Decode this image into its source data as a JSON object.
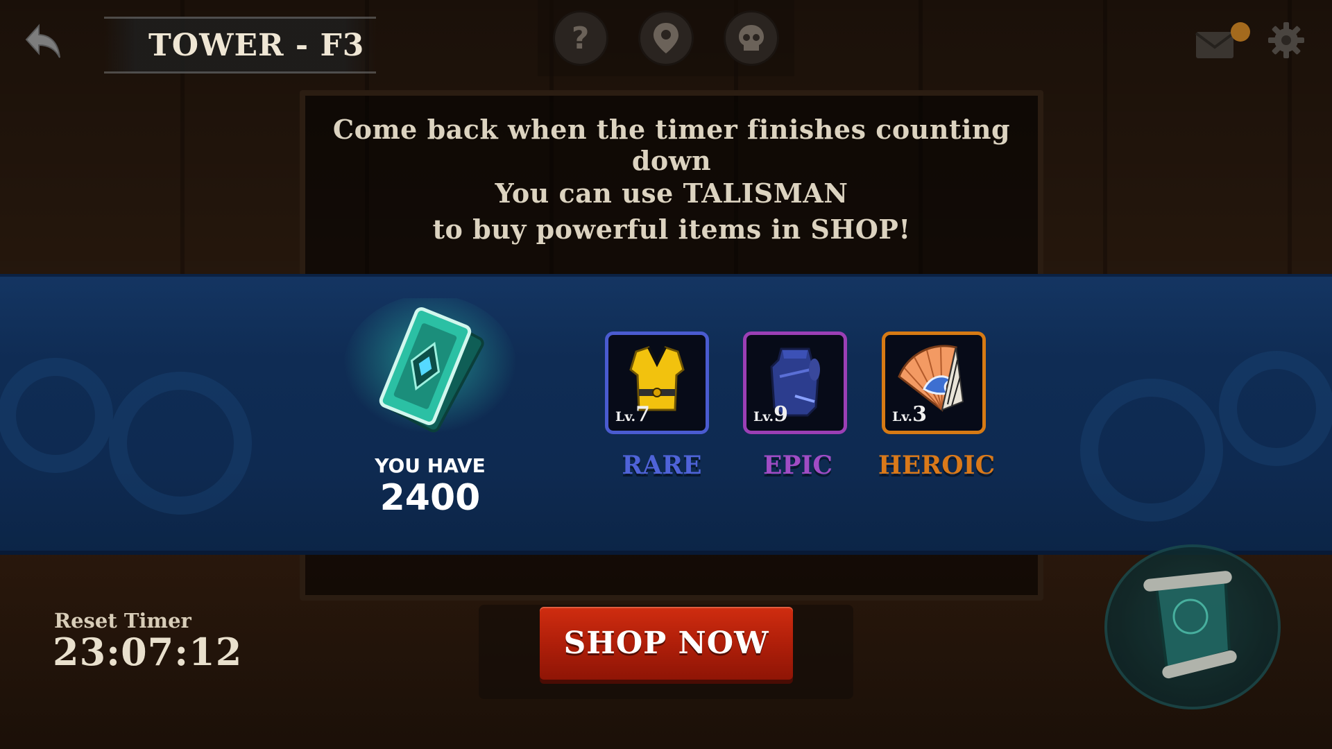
{
  "header": {
    "title": "TOWER - F3",
    "back_icon": "back-arrow-icon",
    "center_icons": [
      "help-icon",
      "map-pin-icon",
      "skull-icon"
    ],
    "mail_icon": "mail-icon",
    "settings_icon": "gear-icon"
  },
  "message": {
    "line1": "Come back when the timer finishes counting down",
    "line2": "You can use TALISMAN",
    "line3": "to buy powerful items in SHOP!"
  },
  "talisman": {
    "icon": "talisman-icon",
    "label": "YOU HAVE",
    "count": "2400"
  },
  "items": [
    {
      "level_prefix": "Lv.",
      "level": "7",
      "rarity": "RARE",
      "color": "#4a5bd0",
      "icon": "yellow-vest-icon"
    },
    {
      "level_prefix": "Lv.",
      "level": "9",
      "rarity": "EPIC",
      "color": "#9b3fb5",
      "icon": "blue-armor-icon"
    },
    {
      "level_prefix": "Lv.",
      "level": "3",
      "rarity": "HEROIC",
      "color": "#d67a14",
      "icon": "wave-fan-icon"
    }
  ],
  "reset_timer": {
    "label": "Reset Timer",
    "value": "23:07:12"
  },
  "shop_button": {
    "label": "SHOP NOW"
  },
  "scroll_button": {
    "icon": "scroll-icon"
  }
}
